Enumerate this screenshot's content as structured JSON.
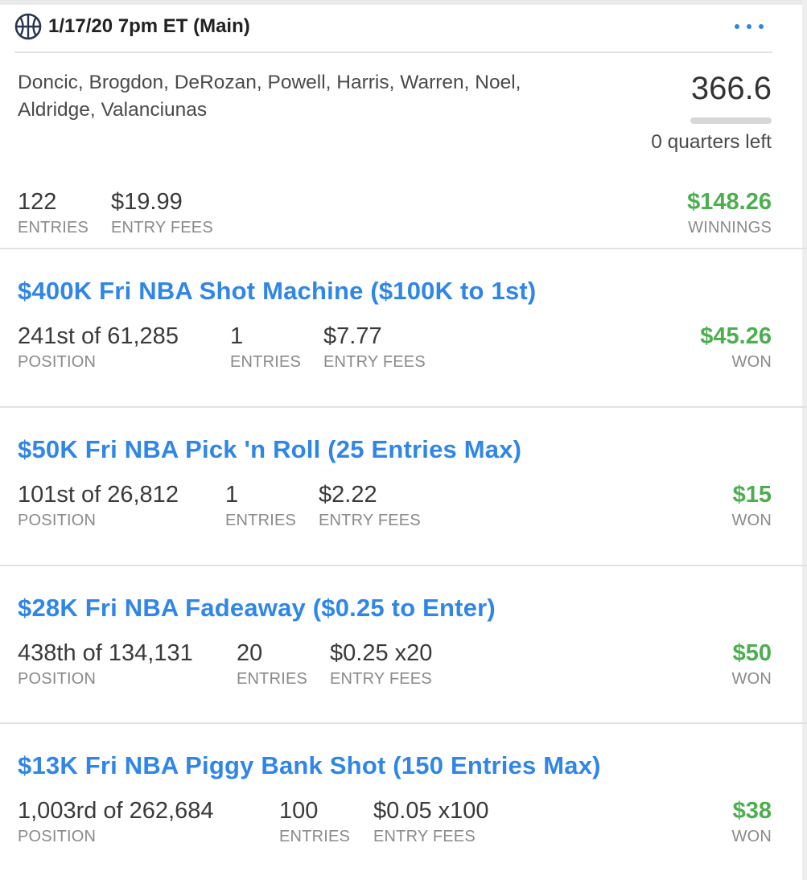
{
  "header": {
    "title": "1/17/20 7pm ET (Main)",
    "icon": "basketball-icon",
    "menu_icon": "more-options-icon"
  },
  "lineup": {
    "players": "Doncic, Brogdon, DeRozan, Powell, Harris, Warren, Noel, Aldridge, Valanciunas",
    "score": "366.6",
    "progress": 1.0,
    "quarters_left": "0 quarters left"
  },
  "summary": {
    "entries_value": "122",
    "entries_label": "ENTRIES",
    "fees_value": "$19.99",
    "fees_label": "ENTRY FEES",
    "winnings_value": "$148.26",
    "winnings_label": "WINNINGS"
  },
  "contests": [
    {
      "title": "$400K Fri NBA Shot Machine ($100K to 1st)",
      "position": "241st of 61,285",
      "position_label": "POSITION",
      "entries": "1",
      "entries_label": "ENTRIES",
      "fees": "$7.77",
      "fees_label": "ENTRY FEES",
      "won": "$45.26",
      "won_label": "WON"
    },
    {
      "title": "$50K Fri NBA Pick 'n Roll (25 Entries Max)",
      "position": "101st of 26,812",
      "position_label": "POSITION",
      "entries": "1",
      "entries_label": "ENTRIES",
      "fees": "$2.22",
      "fees_label": "ENTRY FEES",
      "won": "$15",
      "won_label": "WON"
    },
    {
      "title": "$28K Fri NBA Fadeaway ($0.25 to Enter)",
      "position": "438th of 134,131",
      "position_label": "POSITION",
      "entries": "20",
      "entries_label": "ENTRIES",
      "fees": "$0.25 x20",
      "fees_label": "ENTRY FEES",
      "won": "$50",
      "won_label": "WON"
    },
    {
      "title": "$13K Fri NBA Piggy Bank Shot (150 Entries Max)",
      "position": "1,003rd of 262,684",
      "position_label": "POSITION",
      "entries": "100",
      "entries_label": "ENTRIES",
      "fees": "$0.05 x100",
      "fees_label": "ENTRY FEES",
      "won": "$38",
      "won_label": "WON"
    }
  ],
  "colors": {
    "accent_blue": "#2f86e8",
    "win_green": "#4cae4f",
    "label_gray": "#8a8a8a"
  }
}
